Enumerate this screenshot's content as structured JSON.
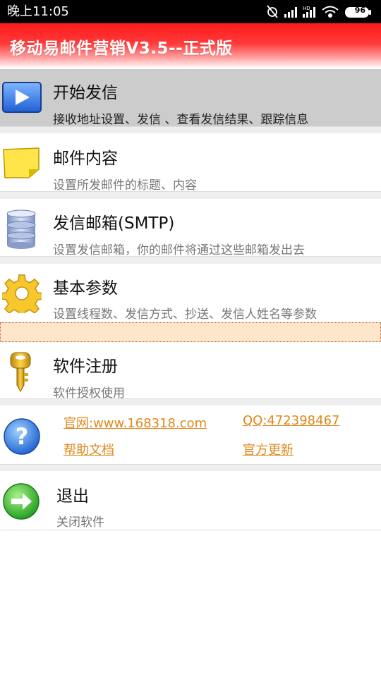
{
  "status": {
    "time": "晚上11:05",
    "battery": "96"
  },
  "app": {
    "title": "移动易邮件营销V3.5--正式版"
  },
  "menu": [
    {
      "label": "开始发信",
      "desc": "接收地址设置、发信 、查看发信结果、跟踪信息",
      "icon": "play-icon"
    },
    {
      "label": "邮件内容",
      "desc": "设置所发邮件的标题、内容",
      "icon": "note-icon"
    },
    {
      "label": "发信邮箱(SMTP)",
      "desc": "设置发信邮箱，你的邮件将通过这些邮箱发出去",
      "icon": "database-icon"
    },
    {
      "label": "基本参数",
      "desc": "设置线程数、发信方式、抄送、发信人姓名等参数",
      "icon": "gear-icon"
    },
    {
      "label": "软件注册",
      "desc": "软件授权使用",
      "icon": "key-icon"
    }
  ],
  "help": {
    "website": "官网:www.168318.com",
    "qq": "QQ:472398467",
    "docs": "帮助文档",
    "update": "官方更新"
  },
  "exit": {
    "label": "退出",
    "desc": "关闭软件"
  },
  "colors": {
    "title_red": "#ff1a1a",
    "selected_bg": "#cccccc",
    "link_orange": "#e0871a"
  }
}
